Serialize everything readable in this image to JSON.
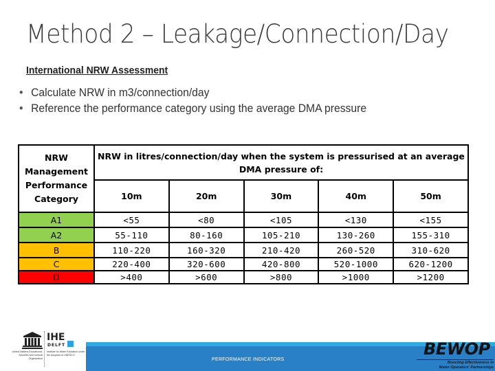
{
  "slide": {
    "title": "Method 2 – Leakage/Connection/Day",
    "subtitle": "International NRW Assessment",
    "bullets": [
      "Calculate NRW in m3/connection/day",
      "Reference the performance category using the average DMA pressure"
    ],
    "bullet_glyph": "•"
  },
  "table": {
    "category_header": [
      "NRW",
      "Management",
      "Performance",
      "Category"
    ],
    "span_header": "NRW in litres/connection/day when the system is pressurised at an average DMA pressure of:",
    "pressures": [
      "10m",
      "20m",
      "30m",
      "40m",
      "50m"
    ],
    "rows": [
      {
        "category": "A1",
        "color": "#92D050",
        "values": [
          "<55",
          "<80",
          "<105",
          "<130",
          "<155"
        ]
      },
      {
        "category": "A2",
        "color": "#92D050",
        "values": [
          "55-110",
          "80-160",
          "105-210",
          "130-260",
          "155-310"
        ]
      },
      {
        "category": "B",
        "color": "#FFC000",
        "values": [
          "110-220",
          "160-320",
          "210-420",
          "260-520",
          "310-620"
        ]
      },
      {
        "category": "C",
        "color": "#FFC000",
        "values": [
          "220-400",
          "320-600",
          "420-800",
          "520-1000",
          "620-1200"
        ]
      },
      {
        "category": "D",
        "color": "#FF0000",
        "values": [
          ">400",
          ">600",
          ">800",
          ">1000",
          ">1200"
        ]
      }
    ]
  },
  "footer": {
    "label": "PERFORMANCE INDICATORS",
    "bar_color": "#2A80C6",
    "strip_color": "#2BABE2"
  },
  "logos": {
    "unesco_text": "United Nations Educational, Scientific and Cultural Organization",
    "ihe_name": "IHE",
    "ihe_sub": "DELFT",
    "ihe_text": "Institute for Water Education under the auspices of UNESCO",
    "bewop_name": "BEWOP",
    "bewop_tagline_1": "Boosting Effectiveness in",
    "bewop_tagline_2": "Water Operators' Partnerships"
  }
}
